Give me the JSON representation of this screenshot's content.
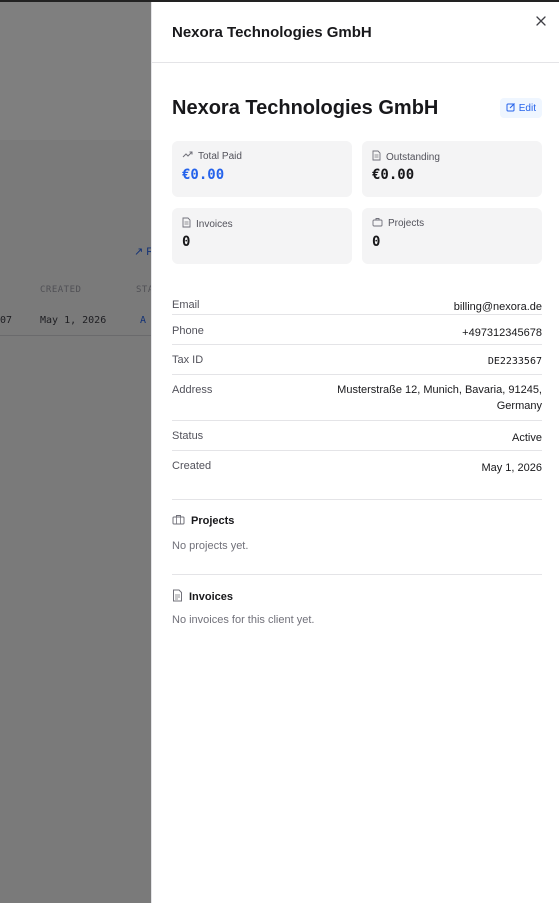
{
  "background": {
    "link": "↗ R",
    "headers": [
      "CREATED",
      "STA"
    ],
    "row": [
      "07",
      "May 1, 2026",
      "A"
    ]
  },
  "sheet": {
    "title": "Nexora Technologies GmbH",
    "close_icon": "close-icon"
  },
  "client": {
    "name": "Nexora Technologies GmbH",
    "edit_label": "Edit"
  },
  "stats": {
    "total_paid": {
      "label": "Total Paid",
      "value": "€0.00",
      "icon": "trending-up-icon"
    },
    "outstanding": {
      "label": "Outstanding",
      "value": "€0.00",
      "icon": "document-icon"
    },
    "invoices": {
      "label": "Invoices",
      "value": "0",
      "icon": "document-icon"
    },
    "projects": {
      "label": "Projects",
      "value": "0",
      "icon": "briefcase-icon"
    }
  },
  "details": {
    "email": {
      "label": "Email",
      "value": "billing@nexora.de"
    },
    "phone": {
      "label": "Phone",
      "value": "+497312345678"
    },
    "tax_id": {
      "label": "Tax ID",
      "value": "DE2233567"
    },
    "address": {
      "label": "Address",
      "line1": "Musterstraße 12, Munich, Bavaria, 91245,",
      "line2": "Germany"
    },
    "status": {
      "label": "Status",
      "value": "Active"
    },
    "created": {
      "label": "Created",
      "value": "May 1, 2026"
    }
  },
  "projects_section": {
    "title": "Projects",
    "empty": "No projects yet."
  },
  "invoices_section": {
    "title": "Invoices",
    "empty": "No invoices for this client yet."
  },
  "colors": {
    "accent": "#2563eb",
    "overlay": "rgba(0,0,0,0.5)"
  }
}
